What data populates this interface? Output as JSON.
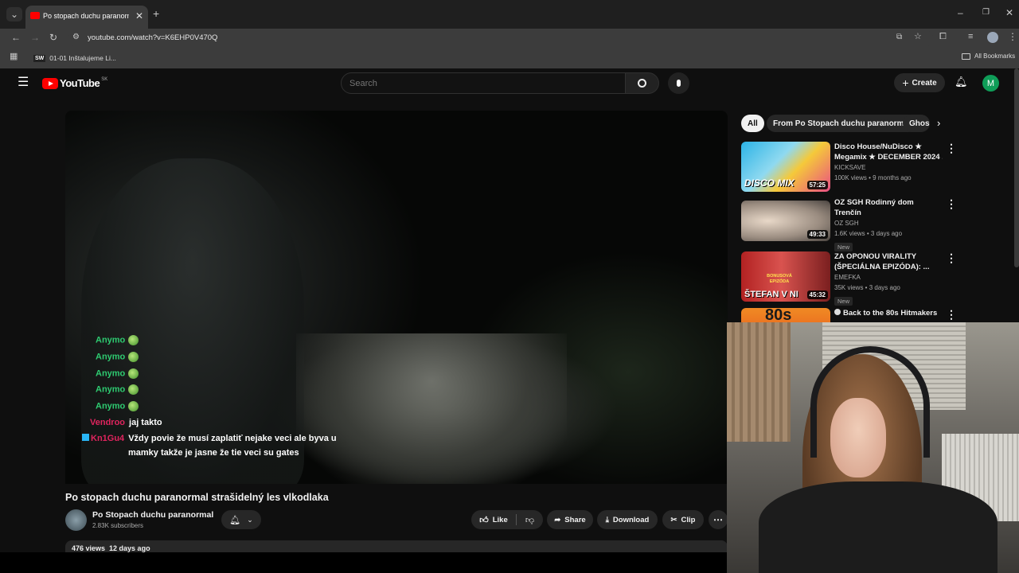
{
  "browser": {
    "tab_title": "Po stopach duchu paranormal",
    "url": "youtube.com/watch?v=K6EHP0V470Q",
    "bookmark_item": "01-01 Inštalujeme Li...",
    "bookmark_favicon_text": "SW",
    "all_bookmarks": "All Bookmarks"
  },
  "youtube": {
    "logo_text": "YouTube",
    "logo_region": "SK",
    "search_placeholder": "Search",
    "create_label": "Create",
    "avatar_letter": "M",
    "accent": "#ff0000"
  },
  "video": {
    "title": "Po stopach duchu paranormal strašidelný les vlkodlaka",
    "channel_name": "Po Stopach duchu paranormal",
    "subscribers": "2.83K subscribers",
    "views_date": "476 views  12 days ago",
    "actions": {
      "like": "Like",
      "share": "Share",
      "download": "Download",
      "clip": "Clip"
    }
  },
  "chat": [
    {
      "user": "Anymo",
      "text": "",
      "color": "#2ecc71",
      "emote": true
    },
    {
      "user": "Anymo",
      "text": "",
      "color": "#2ecc71",
      "emote": true
    },
    {
      "user": "Anymo",
      "text": "",
      "color": "#2ecc71",
      "emote": true
    },
    {
      "user": "Anymo",
      "text": "",
      "color": "#2ecc71",
      "emote": true
    },
    {
      "user": "Anymo",
      "text": "",
      "color": "#2ecc71",
      "emote": true
    },
    {
      "user": "Vendroo",
      "text": "jaj takto",
      "color": "#e0245e",
      "emote": false
    },
    {
      "user": "Kn1Gu4",
      "text": "Vždy povie že musí zaplatiť nejake veci ale byva u",
      "text2": "mamky takže je jasne že tie veci su gates",
      "color": "#e0245e",
      "emote": false
    }
  ],
  "filters": {
    "chips": [
      "All",
      "From Po Stopach duchu paranormal",
      "Ghos"
    ]
  },
  "recommendations": [
    {
      "title1": "Disco House/NuDisco ★",
      "title2": "Megamix ★ DECEMBER 2024 ...",
      "channel": "KICKSAVE",
      "meta": "100K views • 9 months ago",
      "duration": "57:25",
      "badge": ""
    },
    {
      "title1": "OZ SGH Rodinný dom Trenčín",
      "title2": "",
      "channel": "OZ SGH",
      "meta": "1.6K views • 3 days ago",
      "duration": "49:33",
      "badge": "New"
    },
    {
      "title1": "ZA OPONOU VIRALITY",
      "title2": "(ŠPECIÁLNA EPIZÓDA): ...",
      "channel": "EMEFKA",
      "meta": "35K views • 3 days ago",
      "duration": "45:32",
      "badge": "New"
    },
    {
      "title1": "Back to the 80s  Hitmakers",
      "title2": "",
      "channel": "",
      "meta": "",
      "duration": "",
      "badge": ""
    }
  ],
  "thumb_texts": {
    "disco": "DISCO MIX",
    "stefan": "ŠTEFAN V NI",
    "bonus": "BONUSOVÁ EPIZÓDA",
    "eighties": "80s"
  }
}
